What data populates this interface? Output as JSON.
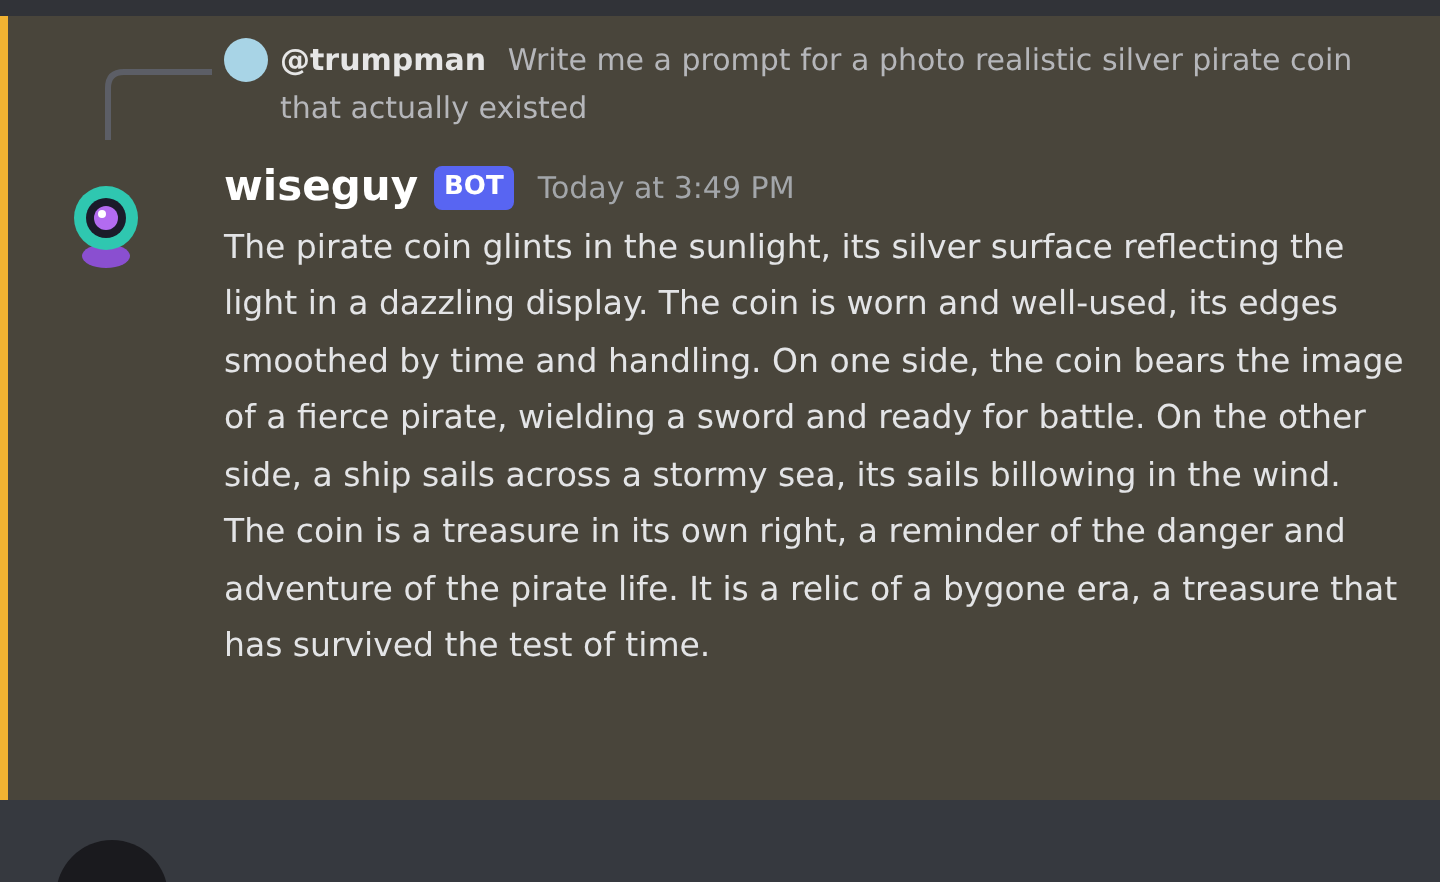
{
  "reply": {
    "username": "@trumpman",
    "text": "Write me a prompt for a photo realistic silver pirate coin that actually existed"
  },
  "message": {
    "username": "wiseguy",
    "badge": "BOT",
    "timestamp": "Today at 3:49 PM",
    "highlighted": true,
    "text": "The pirate coin glints in the sunlight, its silver surface reflecting the light in a dazzling display. The coin is worn and well-used, its edges smoothed by time and handling. On one side, the coin bears the image of a fierce pirate, wielding a sword and ready for battle. On the other side, a ship sails across a stormy sea, its sails billowing in the wind. The coin is a treasure in its own right, a reminder of the danger and adventure of the pirate life. It is a relic of a bygone era, a treasure that has survived the test of time."
  }
}
